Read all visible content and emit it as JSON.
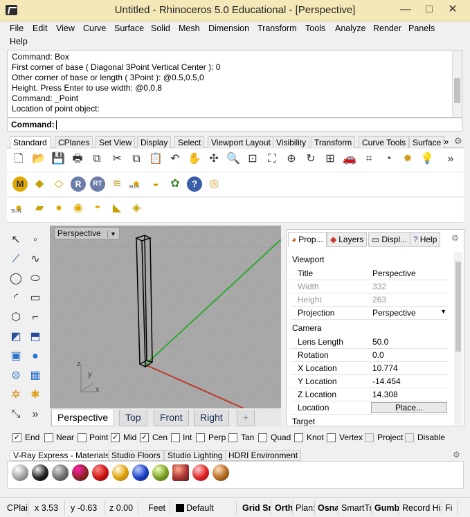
{
  "window": {
    "title": "Untitled - Rhinoceros 5.0 Educational - [Perspective]",
    "min": "—",
    "max": "□",
    "close": "✕"
  },
  "menu": [
    "File",
    "Edit",
    "View",
    "Curve",
    "Surface",
    "Solid",
    "Mesh",
    "Dimension",
    "Transform",
    "Tools",
    "Analyze",
    "Render",
    "Panels",
    "Help"
  ],
  "command_history": [
    "Command: Box",
    "First corner of base ( Diagonal  3Point  Vertical  Center ): 0",
    "Other corner of base or length ( 3Point ): @0.5,0.5,0",
    "Height. Press Enter to use width: @0,0,8",
    "Command: _Point",
    "Location of point object:"
  ],
  "command_prompt": {
    "label": "Command:",
    "value": ""
  },
  "toolbar_tabs": [
    "Standard",
    "CPlanes",
    "Set View",
    "Display",
    "Select",
    "Viewport Layout",
    "Visibility",
    "Transform",
    "Curve Tools",
    "Surface"
  ],
  "toolbar_more": "»",
  "toolbar1_icons": [
    "new-icon",
    "open-icon",
    "save-icon",
    "print-icon",
    "import-icon",
    "cut-icon",
    "copy-icon",
    "paste-icon",
    "undo-icon",
    "pan-icon",
    "rotate-view-icon",
    "zoom-icon",
    "zoom-window-icon",
    "zoom-extents-icon",
    "zoom-selected-icon",
    "rotate-camera-icon",
    "four-views-icon",
    "car-icon",
    "grid-icon",
    "circle-icon",
    "light-icon",
    "bulb-icon"
  ],
  "toolbar2_icons": [
    "vray-m-icon",
    "tag-icon",
    "tag2-icon",
    "vray-r-icon",
    "vray-rt-icon",
    "plane-icon",
    "sun-icon",
    "dome-light-icon",
    "plant-icon",
    "help-icon",
    "target-icon"
  ],
  "toolbar3_icons": [
    "sun-small-icon",
    "rect-light-icon",
    "sphere-light-icon",
    "spot-light-icon",
    "half-dome-icon",
    "ies-light-icon",
    "mesh-light-icon"
  ],
  "sun_label": "SUN",
  "viewport": {
    "label": "Perspective",
    "axis": {
      "z": "z",
      "y": "y",
      "x": "x"
    }
  },
  "viewport_tabs": [
    "Perspective",
    "Top",
    "Front",
    "Right"
  ],
  "viewport_add": "+",
  "panel": {
    "tabs": [
      "Prop...",
      "Layers",
      "Displ...",
      "Help"
    ],
    "sections": {
      "viewport": "Viewport",
      "camera": "Camera",
      "target": "Target"
    },
    "rows": [
      {
        "key": "Title",
        "value": "Perspective"
      },
      {
        "key": "Width",
        "value": "332"
      },
      {
        "key": "Height",
        "value": "263"
      },
      {
        "key": "Projection",
        "value": "Perspective"
      },
      {
        "key": "Lens Length",
        "value": "50.0"
      },
      {
        "key": "Rotation",
        "value": "0.0"
      },
      {
        "key": "X Location",
        "value": "10.774"
      },
      {
        "key": "Y Location",
        "value": "-14.454"
      },
      {
        "key": "Z Location",
        "value": "14.308"
      },
      {
        "key": "Location",
        "value": "Place..."
      }
    ]
  },
  "osnaps": [
    {
      "label": "End",
      "checked": true
    },
    {
      "label": "Near",
      "checked": false
    },
    {
      "label": "Point",
      "checked": false
    },
    {
      "label": "Mid",
      "checked": true
    },
    {
      "label": "Cen",
      "checked": true
    },
    {
      "label": "Int",
      "checked": false
    },
    {
      "label": "Perp",
      "checked": false
    },
    {
      "label": "Tan",
      "checked": false
    },
    {
      "label": "Quad",
      "checked": false
    },
    {
      "label": "Knot",
      "checked": false
    },
    {
      "label": "Vertex",
      "checked": false
    },
    {
      "label": "Project",
      "checked": false
    },
    {
      "label": "Disable",
      "checked": false
    }
  ],
  "material_tabs": [
    "V-Ray Express - Materials",
    "Studio Floors",
    "Studio Lighting",
    "HDRI Environment"
  ],
  "status": {
    "cplane": "CPlai",
    "x": "x 3.53",
    "y": "y -0.63",
    "z": "z 0.00",
    "units": "Feet",
    "layer": "Default",
    "grid": "Grid Sn",
    "ortho": "Orth",
    "planar": "Plan:",
    "osnap": "Osna",
    "smarttrack": "SmartTr",
    "gumball": "Gumb",
    "history": "Record Hi:",
    "filter": "Fi"
  },
  "colors": {
    "title_bg": "#f4e8b8",
    "viewport_bg": "#a8a8a8",
    "x_axis": "#c0392b",
    "y_axis": "#2ea82e"
  }
}
